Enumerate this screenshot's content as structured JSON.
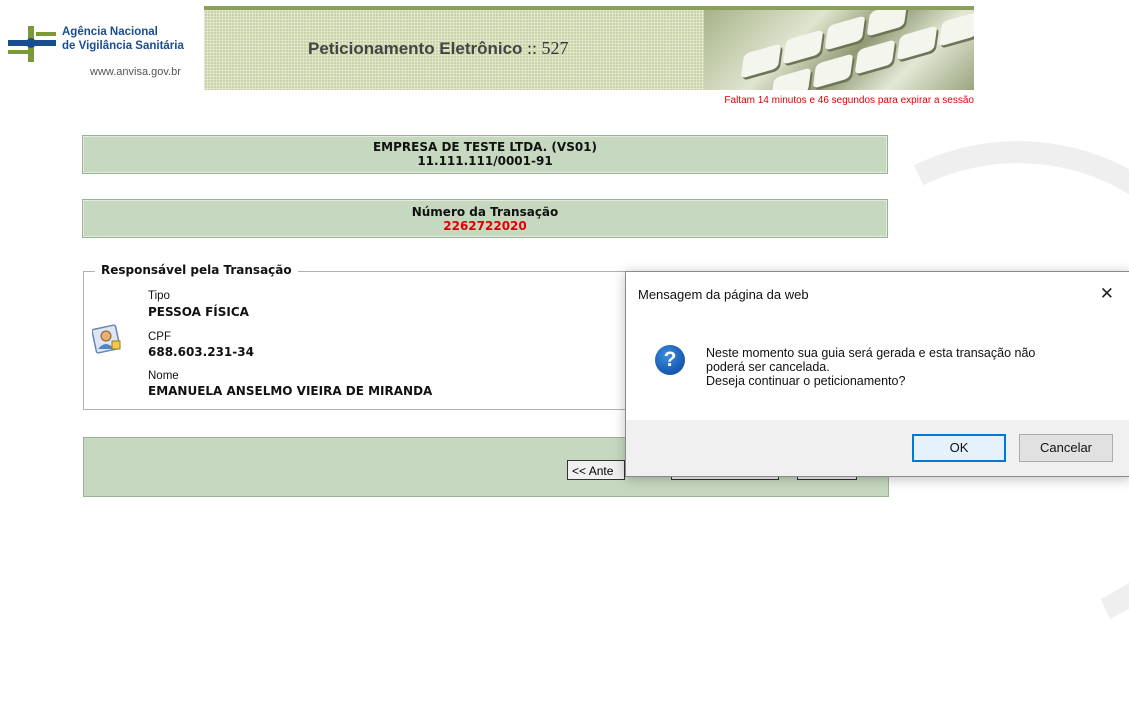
{
  "header": {
    "logo_line1": "Agência Nacional",
    "logo_line2": "de Vigilância Sanitária",
    "logo_url": "www.anvisa.gov.br",
    "title_bold": "Peticionamento Eletrônico",
    "title_rest": " :: 527",
    "session_notice": "Faltam 14 minutos e 46 segundos para expirar a sessão"
  },
  "company": {
    "name": "EMPRESA DE TESTE LTDA. (VS01)",
    "cnpj": "11.111.111/0001-91"
  },
  "transaction": {
    "label": "Número da Transação",
    "number": "2262722020"
  },
  "responsible": {
    "legend": "Responsável pela Transação",
    "type_label": "Tipo",
    "type_value": "PESSOA FÍSICA",
    "cpf_label": "CPF",
    "cpf_value": "688.603.231-34",
    "name_label": "Nome",
    "name_value": "EMANUELA ANSELMO VIEIRA DE MIRANDA"
  },
  "navigation": {
    "prev_label": "<< Ante"
  },
  "dialog": {
    "title": "Mensagem da página da web",
    "close_glyph": "✕",
    "icon_glyph": "?",
    "message_line1": "Neste momento sua guia será gerada e esta transação não",
    "message_line2": "poderá ser cancelada.",
    "message_line3": "Deseja continuar o peticionamento?",
    "ok_label": "OK",
    "cancel_label": "Cancelar"
  },
  "colors": {
    "panel_green": "#c6d9c0",
    "alert_red": "#e00000",
    "accent_blue": "#0078d7"
  }
}
